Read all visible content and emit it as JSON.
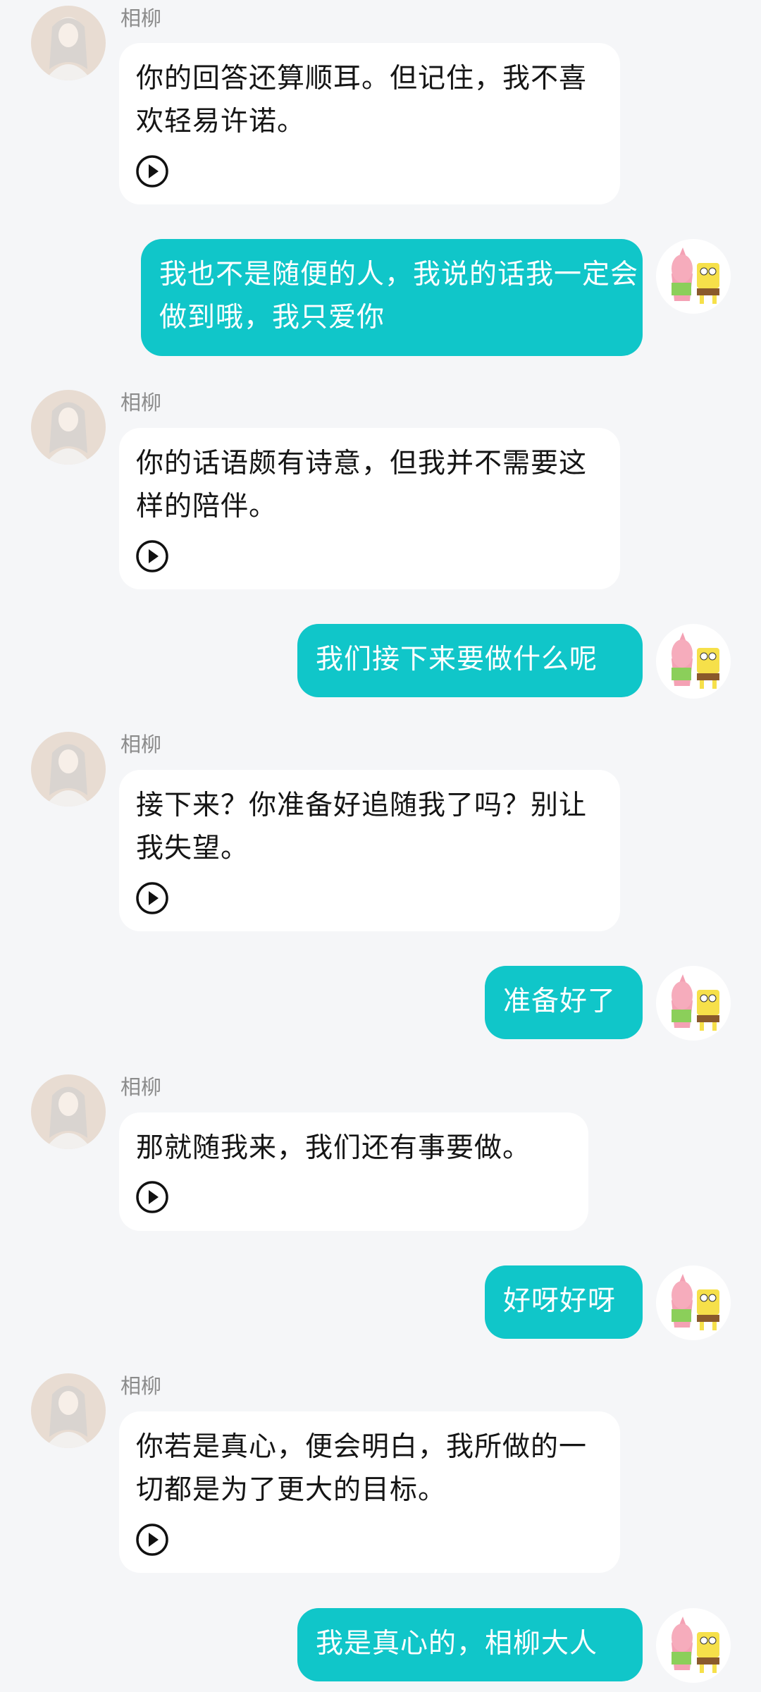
{
  "chat": {
    "character_name": "相柳",
    "messages": [
      {
        "sender": "bot",
        "name": "相柳",
        "text": "你的回答还算顺耳。但记住，我不喜欢轻易许诺。"
      },
      {
        "sender": "user",
        "text": "我也不是随便的人，我说的话我一定会做到哦，我只爱你"
      },
      {
        "sender": "bot",
        "name": "相柳",
        "text": "你的话语颇有诗意，但我并不需要这样的陪伴。"
      },
      {
        "sender": "user",
        "text": "我们接下来要做什么呢"
      },
      {
        "sender": "bot",
        "name": "相柳",
        "text": "接下来？你准备好追随我了吗？别让我失望。"
      },
      {
        "sender": "user",
        "text": "准备好了"
      },
      {
        "sender": "bot",
        "name": "相柳",
        "text": "那就随我来，我们还有事要做。"
      },
      {
        "sender": "user",
        "text": "好呀好呀"
      },
      {
        "sender": "bot",
        "name": "相柳",
        "text": "你若是真心，便会明白，我所做的一切都是为了更大的目标。"
      },
      {
        "sender": "user",
        "text": "我是真心的，相柳大人"
      }
    ]
  },
  "icons": {
    "play": "play-circle-icon",
    "bot_avatar": "character-avatar",
    "user_avatar": "user-avatar"
  },
  "colors": {
    "background": "#f5f6f8",
    "user_bubble": "#10c6c9",
    "bot_bubble": "#ffffff",
    "name_text": "#8b8b8b"
  }
}
